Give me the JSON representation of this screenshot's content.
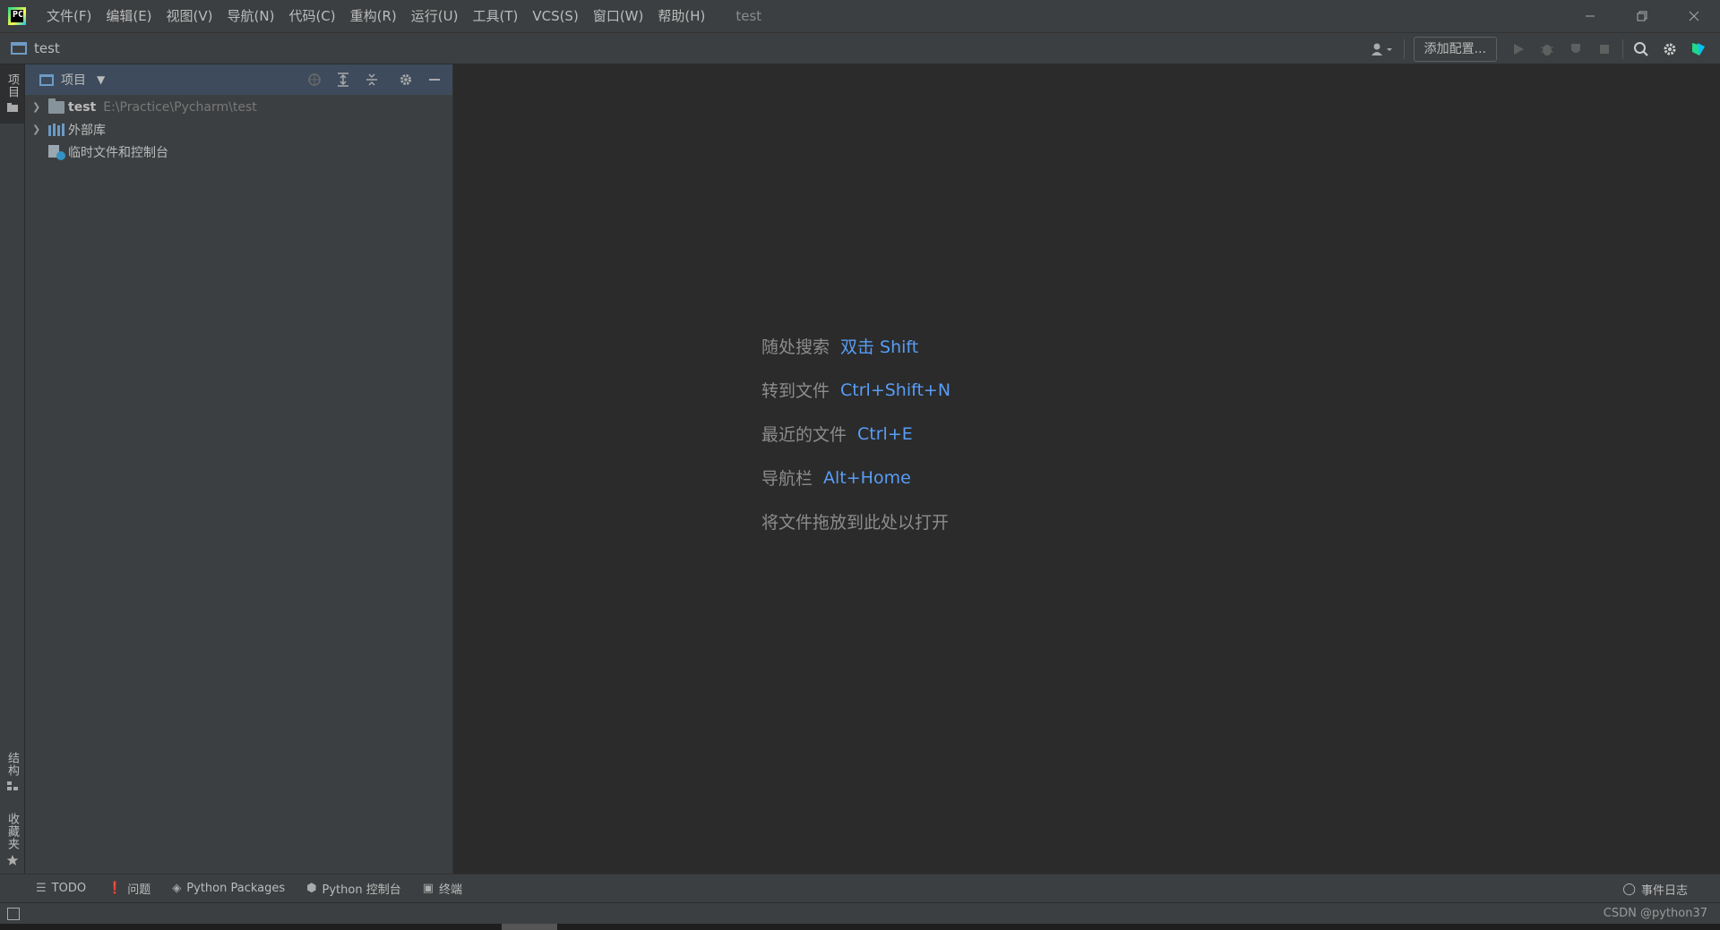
{
  "menu": {
    "items": [
      "文件(F)",
      "编辑(E)",
      "视图(V)",
      "导航(N)",
      "代码(C)",
      "重构(R)",
      "运行(U)",
      "工具(T)",
      "VCS(S)",
      "窗口(W)",
      "帮助(H)"
    ],
    "window_title": "test"
  },
  "navbar": {
    "project_name": "test",
    "run_config_label": "添加配置..."
  },
  "left_stripe": {
    "project_tab": "项目",
    "structure_tab": "结构",
    "favorites_tab": "收藏夹"
  },
  "project_panel": {
    "title": "项目",
    "tree": [
      {
        "name": "test",
        "path": "E:\\Practice\\Pycharm\\test"
      },
      {
        "name": "外部库"
      },
      {
        "name": "临时文件和控制台"
      }
    ]
  },
  "editor": {
    "hints": [
      {
        "label": "随处搜索",
        "key": "双击 Shift"
      },
      {
        "label": "转到文件",
        "key": "Ctrl+Shift+N"
      },
      {
        "label": "最近的文件",
        "key": "Ctrl+E"
      },
      {
        "label": "导航栏",
        "key": "Alt+Home"
      },
      {
        "label": "将文件拖放到此处以打开",
        "key": ""
      }
    ]
  },
  "bottom_bar": {
    "tabs": [
      "TODO",
      "问题",
      "Python Packages",
      "Python 控制台",
      "终端"
    ],
    "event_log": "事件日志"
  },
  "status_bar": {
    "watermark": "CSDN @python37"
  },
  "colors": {
    "background": "#2b2b2b",
    "panel": "#3c3f41",
    "accent_key": "#589df6",
    "panel_header": "#3d4b5c"
  }
}
